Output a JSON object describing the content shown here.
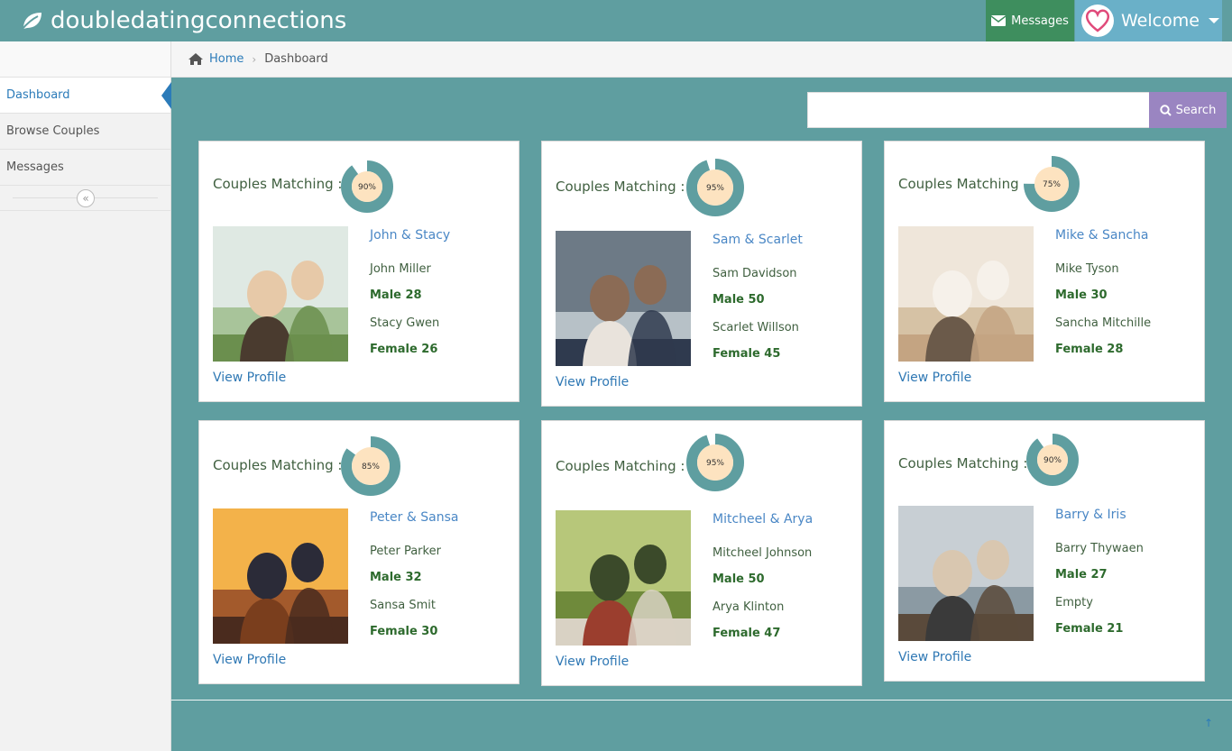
{
  "brand": {
    "name": "doubledatingconnections",
    "icon": "leaf-icon"
  },
  "nav": {
    "messages_label": "Messages",
    "welcome_label": "Welcome"
  },
  "sidebar": {
    "items": [
      {
        "label": "Dashboard",
        "active": true
      },
      {
        "label": "Browse Couples",
        "active": false
      },
      {
        "label": "Messages",
        "active": false
      }
    ]
  },
  "breadcrumb": {
    "home": "Home",
    "current": "Dashboard"
  },
  "search": {
    "button_label": "Search",
    "value": ""
  },
  "match_label": "Couples Matching :",
  "view_profile_label": "View Profile",
  "colors": {
    "ring": "#5f9ea0",
    "ring_center": "#fde3c0",
    "accent": "#2b7bb9",
    "search_button": "#9a85c1"
  },
  "couples": [
    {
      "name": "John & Stacy",
      "match_percent": 90,
      "match_text": "90%",
      "p1_name": "John Miller",
      "p1_stat": "Male 28",
      "p2_name": "Stacy Gwen",
      "p2_stat": "Female 26"
    },
    {
      "name": "Sam & Scarlet",
      "match_percent": 95,
      "match_text": "95%",
      "p1_name": "Sam Davidson",
      "p1_stat": "Male 50",
      "p2_name": "Scarlet Willson",
      "p2_stat": "Female 45"
    },
    {
      "name": "Mike & Sancha",
      "match_percent": 75,
      "match_text": "75%",
      "p1_name": "Mike Tyson",
      "p1_stat": "Male 30",
      "p2_name": "Sancha Mitchille",
      "p2_stat": "Female 28"
    },
    {
      "name": "Peter & Sansa",
      "match_percent": 85,
      "match_text": "85%",
      "p1_name": "Peter Parker",
      "p1_stat": "Male 32",
      "p2_name": "Sansa Smit",
      "p2_stat": "Female 30"
    },
    {
      "name": "Mitcheel & Arya",
      "match_percent": 95,
      "match_text": "95%",
      "p1_name": "Mitcheel Johnson",
      "p1_stat": "Male 50",
      "p2_name": "Arya Klinton",
      "p2_stat": "Female 47"
    },
    {
      "name": "Barry & Iris",
      "match_percent": 90,
      "match_text": "90%",
      "p1_name": "Barry Thywaen",
      "p1_stat": "Male 27",
      "p2_name": "Empty",
      "p2_stat": "Female 21"
    }
  ]
}
